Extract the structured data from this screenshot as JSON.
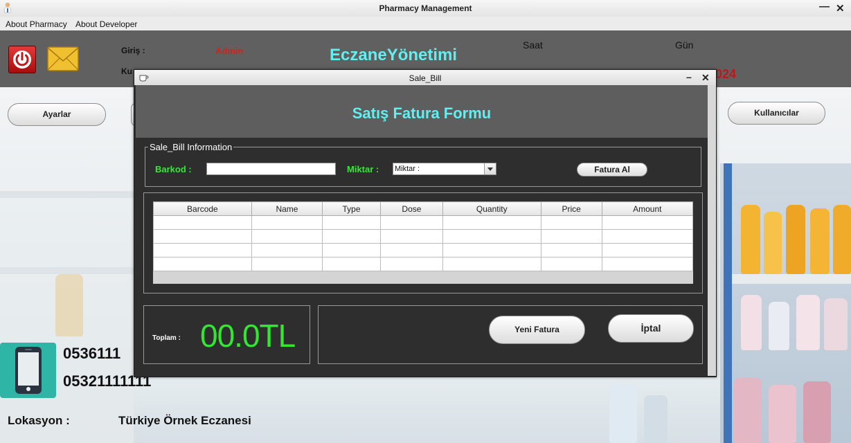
{
  "window": {
    "title": "Pharmacy Management",
    "minimize_glyph": "—",
    "close_glyph": "✕"
  },
  "menu": {
    "items": [
      "About Pharmacy",
      "About Developer"
    ]
  },
  "header": {
    "login_label": "Giriş :",
    "login_value": "Admin",
    "user_label_partial": "Ku",
    "app_name": "EczaneYönetimi",
    "time_label": "Saat",
    "day_label": "Gün",
    "year_partial": "024"
  },
  "side": {
    "settings_button": "Ayarlar",
    "users_button": "Kullanıcılar",
    "phone_1_partial": "0536111",
    "phone_2": "05321111111",
    "location_label": "Lokasyon :",
    "location_value": "Türkiye Örnek Eczanesi"
  },
  "dialog": {
    "title": "Sale_Bill",
    "minimize_glyph": "–",
    "close_glyph": "✕",
    "banner_title": "Satış Fatura Formu",
    "group_title": "Sale_Bill Information",
    "barcode_label": "Barkod :",
    "barcode_value": "",
    "quantity_label": "Miktar :",
    "quantity_selected": "Miktar :",
    "get_bill_button": "Fatura Al",
    "table": {
      "columns": [
        "Barcode",
        "Name",
        "Type",
        "Dose",
        "Quantity",
        "Price",
        "Amount"
      ],
      "rows": [
        [
          "",
          "",
          "",
          "",
          "",
          "",
          ""
        ],
        [
          "",
          "",
          "",
          "",
          "",
          "",
          ""
        ],
        [
          "",
          "",
          "",
          "",
          "",
          "",
          ""
        ],
        [
          "",
          "",
          "",
          "",
          "",
          "",
          ""
        ]
      ]
    },
    "total_label": "Toplam :",
    "total_value": "00.0TL",
    "new_bill_button": "Yeni Fatura",
    "cancel_button": "İptal"
  },
  "colors": {
    "header_bg": "#606060",
    "dialog_bg": "#2e2e2e",
    "banner_text": "#5ff0f0",
    "label_green": "#39e639",
    "total_green": "#32e632",
    "admin_red": "#d42020"
  }
}
